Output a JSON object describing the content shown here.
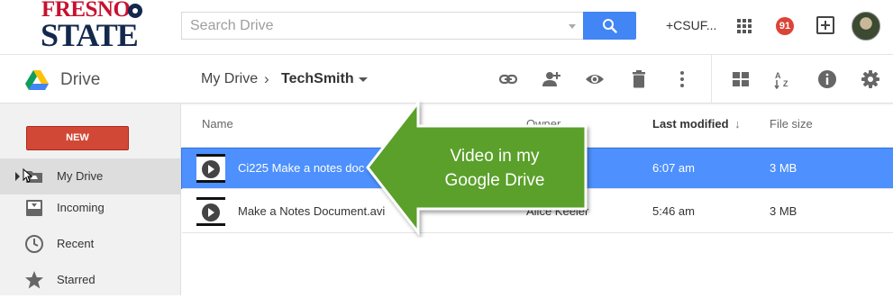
{
  "header": {
    "logo_line1": "FRESNO",
    "logo_line2": "STATE",
    "search_placeholder": "Search Drive",
    "user_name": "+CSUF...",
    "notification_count": "91",
    "accent_color": "#4285f4"
  },
  "drivebar": {
    "title": "Drive",
    "breadcrumb_root": "My Drive",
    "breadcrumb_sep": "›",
    "breadcrumb_current": "TechSmith",
    "tools": [
      "link-icon",
      "add-person-icon",
      "eye-icon",
      "trash-icon",
      "more-vert-icon",
      "grid-view-icon",
      "sort-az-icon",
      "info-icon",
      "settings-icon"
    ]
  },
  "sidebar": {
    "new_label": "NEW",
    "new_color": "#d14836",
    "items": [
      {
        "label": "My Drive",
        "icon": "drive-folder-icon",
        "active": true
      },
      {
        "label": "Incoming",
        "icon": "incoming-tray-icon"
      },
      {
        "label": "Recent",
        "icon": "clock-icon"
      },
      {
        "label": "Starred",
        "icon": "star-icon"
      }
    ]
  },
  "files": {
    "columns": {
      "name": "Name",
      "owner": "Owner",
      "modified": "Last modified",
      "sort_arrow": "↓",
      "size": "File size"
    },
    "rows": [
      {
        "name": "Ci225 Make a notes doc",
        "owner": "",
        "modified": "6:07 am",
        "size": "3 MB",
        "selected": true
      },
      {
        "name": "Make a Notes Document.avi",
        "owner": "Alice Keeler",
        "modified": "5:46 am",
        "size": "3 MB",
        "selected": false
      }
    ],
    "selection_color": "#4d90fe"
  },
  "annotation": {
    "line1": "Video in my",
    "line2": "Google Drive",
    "color": "#5aa02c"
  }
}
